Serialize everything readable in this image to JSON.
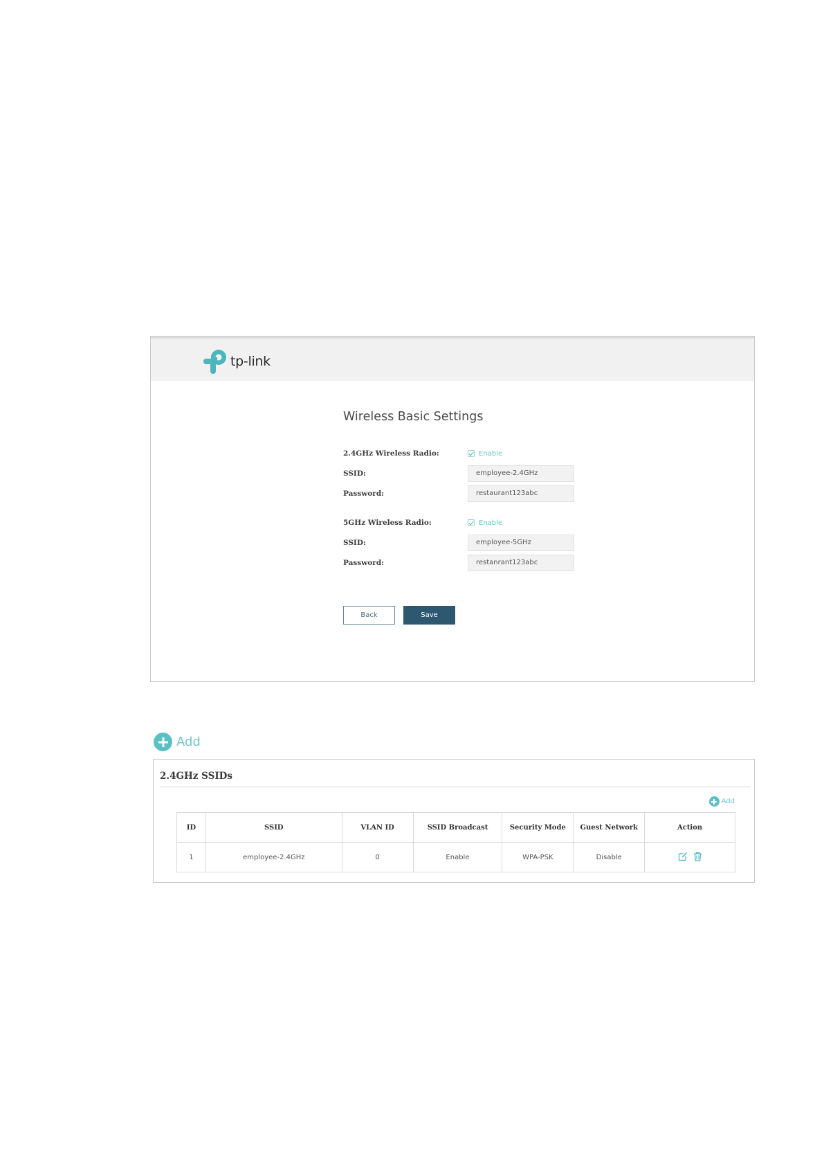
{
  "settings_window": {
    "logo_text": "tp-link",
    "page_title": "Wireless Basic Settings",
    "radio_24": {
      "label": "2.4GHz Wireless Radio:",
      "enable_label": "Enable",
      "enabled": true
    },
    "ssid_24": {
      "label": "SSID:",
      "value": "employee-2.4GHz"
    },
    "password_24": {
      "label": "Password:",
      "value": "restaurant123abc"
    },
    "radio_5": {
      "label": "5GHz Wireless Radio:",
      "enable_label": "Enable",
      "enabled": true
    },
    "ssid_5": {
      "label": "SSID:",
      "value": "employee-5GHz"
    },
    "password_5": {
      "label": "Password:",
      "value": "restanrant123abc"
    },
    "back_label": "Back",
    "save_label": "Save"
  },
  "add_button": {
    "label": "Add"
  },
  "ssid_panel": {
    "title": "2.4GHz SSIDs",
    "add_label": "Add",
    "columns": [
      "ID",
      "SSID",
      "VLAN ID",
      "SSID Broadcast",
      "Security Mode",
      "Guest Network",
      "Action"
    ],
    "rows": [
      {
        "id": "1",
        "ssid": "employee-2.4GHz",
        "vlan_id": "0",
        "broadcast": "Enable",
        "security": "WPA-PSK",
        "guest": "Disable",
        "actions": [
          "edit-icon",
          "delete-icon"
        ]
      }
    ]
  },
  "colors": {
    "accent": "#5bc0c4",
    "save_button": "#2d5870",
    "topbar": "#f1f1f1"
  }
}
